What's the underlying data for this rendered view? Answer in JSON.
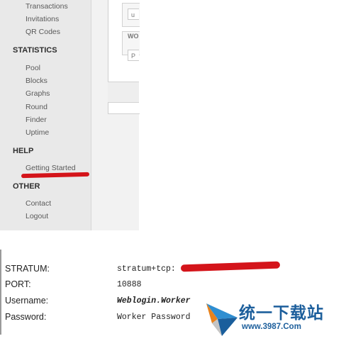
{
  "sidebar": {
    "account_items": [
      "Transactions",
      "Invitations",
      "QR Codes"
    ],
    "statistics_heading": "STATISTICS",
    "statistics_items": [
      "Pool",
      "Blocks",
      "Graphs",
      "Round",
      "Finder",
      "Uptime"
    ],
    "help_heading": "HELP",
    "help_items": [
      "Getting Started"
    ],
    "other_heading": "OTHER",
    "other_items": [
      "Contact",
      "Logout"
    ]
  },
  "panel": {
    "field1_value": "u",
    "field2_label": "WO",
    "field2_value": "P"
  },
  "stratum_info": {
    "stratum_label": "STRATUM:",
    "stratum_value": "stratum+tcp:",
    "port_label": "PORT:",
    "port_value": "10888",
    "username_label": "Username:",
    "username_value": "Weblogin.Worker",
    "password_label": "Password:",
    "password_value": "Worker Password"
  },
  "watermark": {
    "title": "统一下载站",
    "url": "www.3987.Com"
  },
  "colors": {
    "highlight_red": "#d4141a",
    "watermark_blue": "#1d5f9c"
  }
}
